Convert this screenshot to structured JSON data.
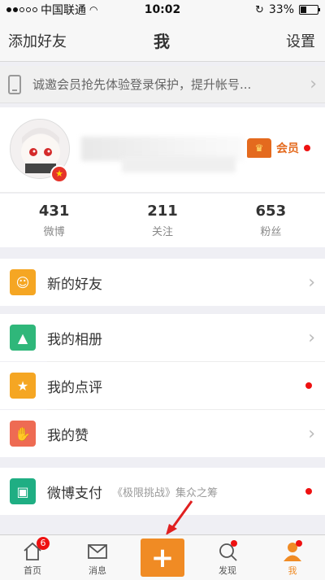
{
  "status_bar": {
    "carrier": "中国联通",
    "time": "10:02",
    "battery": "33%"
  },
  "nav": {
    "left": "添加好友",
    "title": "我",
    "right": "设置"
  },
  "banner": {
    "text": "诚邀会员抢先体验登录保护，提升帐号..."
  },
  "profile": {
    "vip_label": "会员"
  },
  "stats": [
    {
      "num": "431",
      "label": "微博"
    },
    {
      "num": "211",
      "label": "关注"
    },
    {
      "num": "653",
      "label": "粉丝"
    }
  ],
  "menu": {
    "new_friends": "新的好友",
    "albums": "我的相册",
    "reviews": "我的点评",
    "likes": "我的赞",
    "pay": "微博支付",
    "pay_sub": "《极限挑战》集众之筹"
  },
  "tabs": {
    "home": "首页",
    "home_badge": "6",
    "messages": "消息",
    "discover": "发现",
    "me": "我"
  },
  "colors": {
    "accent": "#f08b24",
    "badge_red": "#ee1111"
  }
}
